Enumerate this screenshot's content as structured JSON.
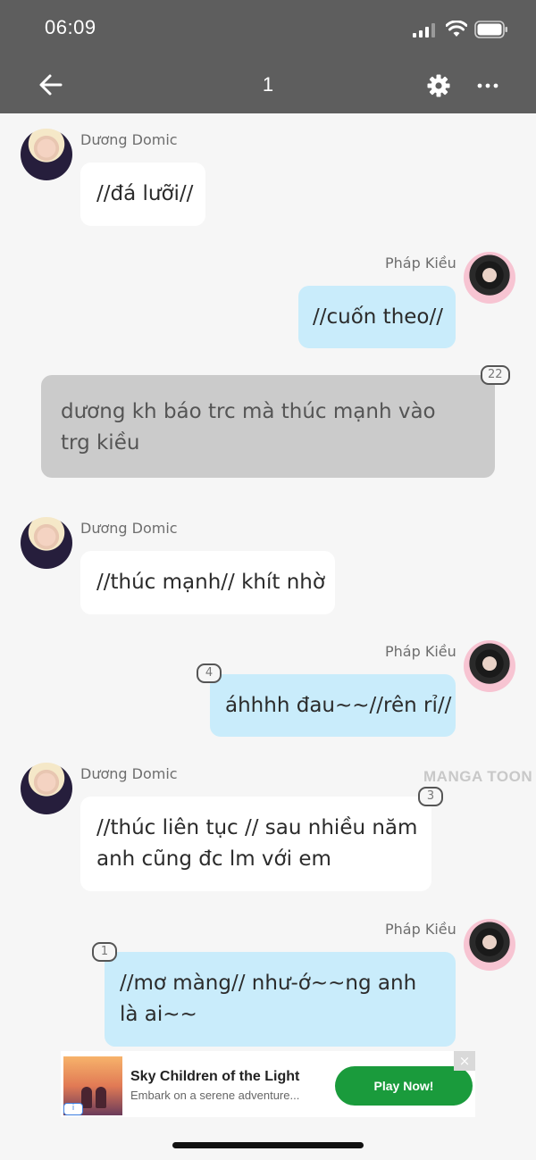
{
  "status_bar": {
    "time": "06:09"
  },
  "header": {
    "title": "1"
  },
  "messages": [
    {
      "sender": "Dương Domic",
      "text_lines": [
        "//đá lưỡi//"
      ]
    },
    {
      "sender": "Pháp Kiều",
      "text_lines": [
        "//cuốn theo//"
      ]
    },
    {
      "narration_lines": [
        "dương kh báo trc mà thúc mạnh vào",
        "trg kiều"
      ],
      "count": "22"
    },
    {
      "sender": "Dương Domic",
      "text_lines": [
        "//thúc mạnh// khít nhờ"
      ]
    },
    {
      "sender": "Pháp Kiều",
      "text_lines": [
        "áhhhh đau~~//rên rỉ//"
      ],
      "count": "4"
    },
    {
      "sender": "Dương Domic",
      "text_lines": [
        "//thúc liên tục // sau nhiều năm",
        "anh cũng đc lm với em"
      ],
      "count": "3"
    },
    {
      "sender": "Pháp Kiều",
      "text_lines": [
        "//mơ màng// như-ớ~~ng anh",
        "là ai~~"
      ],
      "count": "1"
    }
  ],
  "watermark": "MANGA TOON",
  "ad": {
    "title": "Sky Children of the Light",
    "subtitle": "Embark on a serene adventure...",
    "button": "Play Now!",
    "badge": "i",
    "close": "×"
  },
  "colors": {
    "header_bg": "#5e5e5e",
    "bubble_blue": "#c9ecfb",
    "narration_gray": "#cbcbcb",
    "cta_green": "#1a9b3c"
  }
}
